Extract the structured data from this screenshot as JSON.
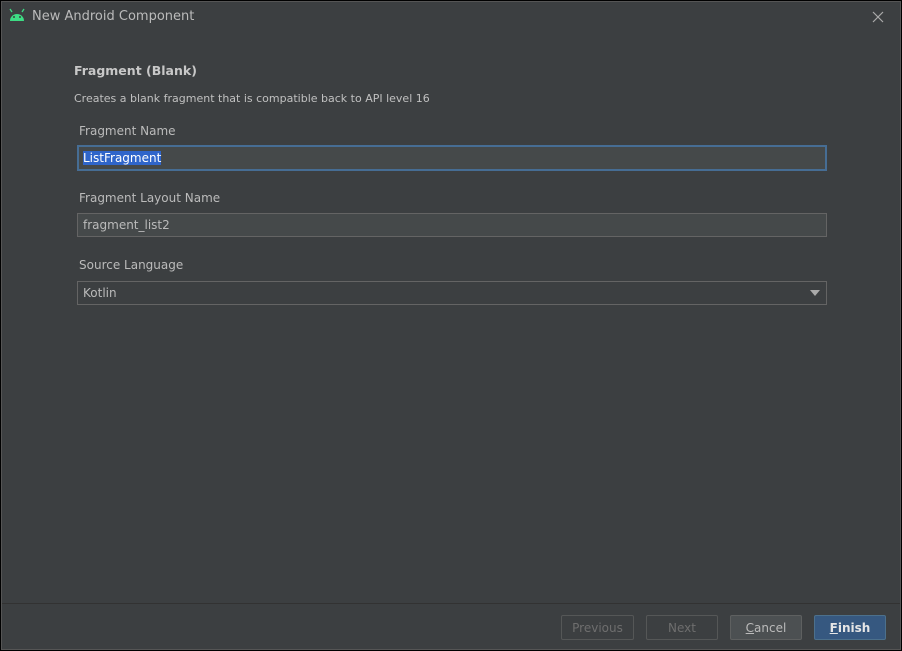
{
  "window": {
    "title": "New Android Component",
    "icon": "android-icon",
    "close_icon": "close-icon"
  },
  "template": {
    "heading": "Fragment (Blank)",
    "description": "Creates a blank fragment that is compatible back to API level 16"
  },
  "fields": {
    "fragment_name": {
      "label": "Fragment Name",
      "value": "ListFragment"
    },
    "layout_name": {
      "label": "Fragment Layout Name",
      "value": "fragment_list2"
    },
    "source_language": {
      "label": "Source Language",
      "value": "Kotlin"
    }
  },
  "buttons": {
    "previous": "Previous",
    "next": "Next",
    "cancel_mnemonic": "C",
    "cancel_rest": "ancel",
    "finish_mnemonic": "F",
    "finish_rest": "inish"
  },
  "colors": {
    "background": "#3c3f41",
    "accent": "#365880",
    "android_green": "#3ddc84",
    "selection": "#2f65ca"
  }
}
